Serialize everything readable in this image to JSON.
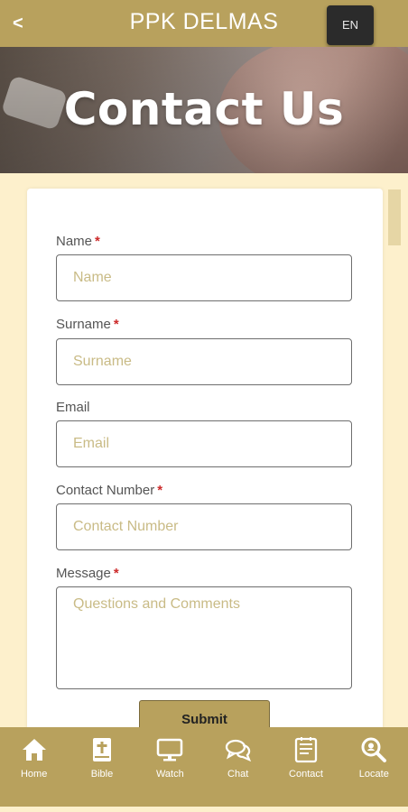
{
  "header": {
    "back_label": "<",
    "title": "PPK DELMAS",
    "language": "EN"
  },
  "hero": {
    "title": "Contact Us"
  },
  "form": {
    "name": {
      "label": "Name",
      "required": "*",
      "placeholder": "Name"
    },
    "surname": {
      "label": "Surname",
      "required": "*",
      "placeholder": "Surname"
    },
    "email": {
      "label": "Email",
      "placeholder": "Email"
    },
    "contact_number": {
      "label": "Contact Number",
      "required": "*",
      "placeholder": "Contact Number"
    },
    "message": {
      "label": "Message",
      "required": "*",
      "placeholder": "Questions and Comments"
    },
    "submit_label": "Submit"
  },
  "nav": {
    "items": [
      {
        "label": "Home",
        "icon": "home-icon"
      },
      {
        "label": "Bible",
        "icon": "bible-icon"
      },
      {
        "label": "Watch",
        "icon": "monitor-icon"
      },
      {
        "label": "Chat",
        "icon": "chat-icon"
      },
      {
        "label": "Contact",
        "icon": "contact-icon"
      },
      {
        "label": "Locate",
        "icon": "search-location-icon"
      }
    ]
  },
  "colors": {
    "brand": "#b8a15d",
    "background": "#fdf0cc",
    "required": "#cc2a2a",
    "placeholder": "#c9bb86"
  }
}
